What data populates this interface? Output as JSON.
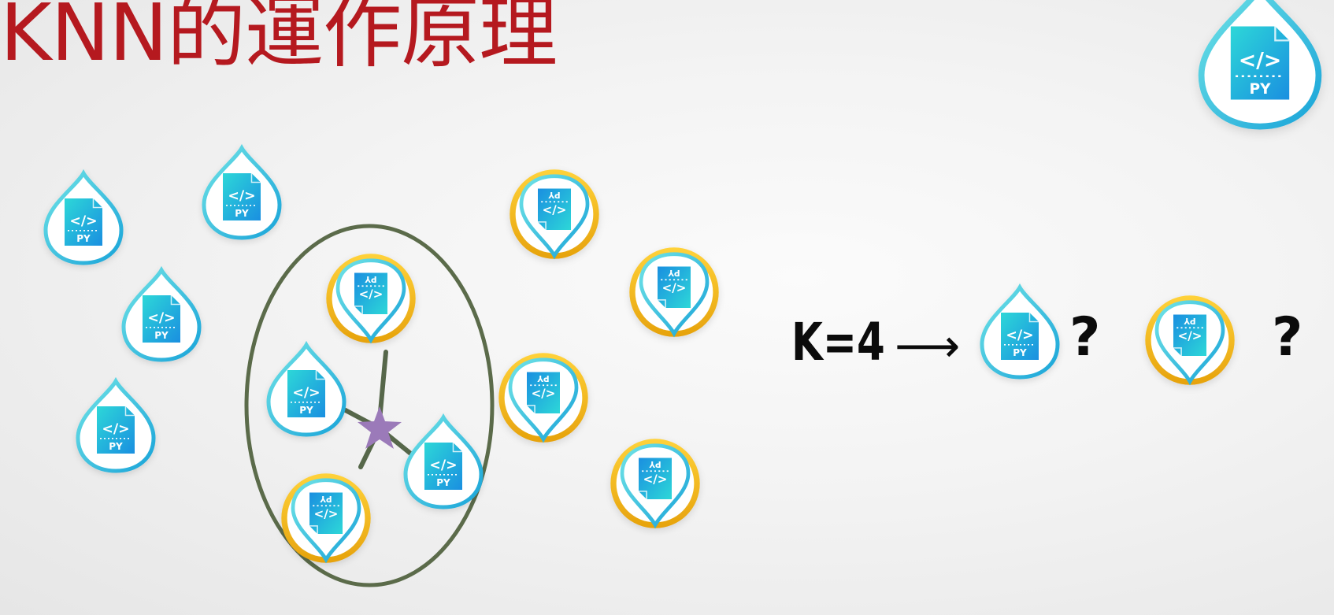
{
  "slide": {
    "title": "KNN的運作原理",
    "formula": "K=4",
    "arrow": "⟶",
    "question_marks": [
      "?",
      "?"
    ]
  },
  "icons": {
    "blue_label": "PY",
    "yellow_label": "PY"
  },
  "colors": {
    "title": "#b5191f",
    "cyan_class": "#1fbcd3",
    "yellow_ring": "#f3b81c",
    "circle_outline": "#5b6b4a",
    "star": "#9b7ab9",
    "text": "#0b0b0b"
  },
  "scene": {
    "k": 4,
    "blue_points": 8,
    "yellow_points": 6,
    "unknown_points": 1
  }
}
